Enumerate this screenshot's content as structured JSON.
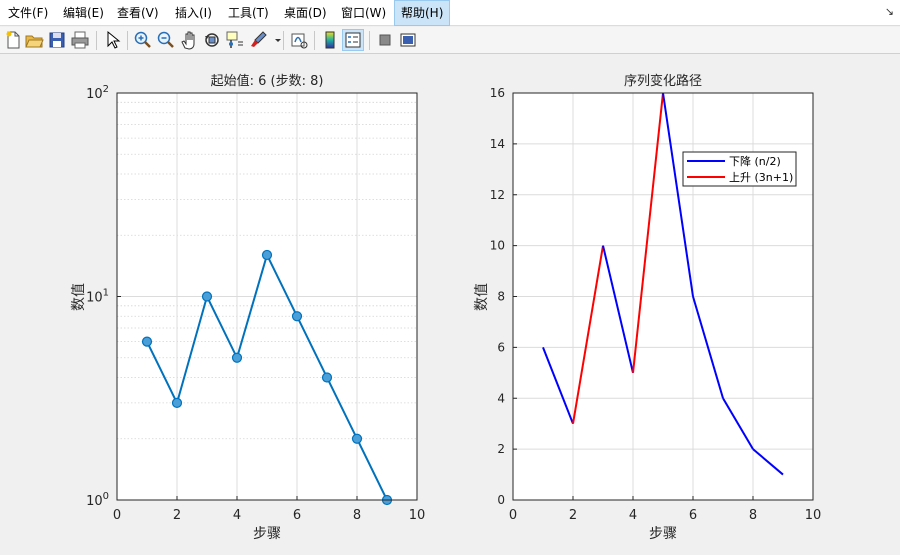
{
  "menu": {
    "items": [
      "文件(F)",
      "编辑(E)",
      "查看(V)",
      "插入(I)",
      "工具(T)",
      "桌面(D)",
      "窗口(W)",
      "帮助(H)"
    ],
    "active_index": 7,
    "dock_glyph": "↘"
  },
  "toolbar": {
    "icons": [
      "new-figure-icon",
      "open-file-icon",
      "save-icon",
      "print-icon",
      "select-pointer-icon",
      "zoom-in-icon",
      "zoom-out-icon",
      "pan-hand-icon",
      "rotate-3d-icon",
      "data-cursor-icon",
      "brush-icon",
      "link-plot-icon",
      "insert-colorbar-icon",
      "insert-legend-icon",
      "hide-plot-tools-icon",
      "show-plot-tools-icon"
    ]
  },
  "chart_data": [
    {
      "type": "line",
      "title": "起始值: 6 (步数: 8)",
      "xlabel": "步骤",
      "ylabel": "数值",
      "yscale": "log",
      "xlim": [
        0,
        10
      ],
      "ylim": [
        1,
        100
      ],
      "xticks": [
        0,
        2,
        4,
        6,
        8,
        10
      ],
      "yticks": [
        {
          "base": "10",
          "exp": "0"
        },
        {
          "base": "10",
          "exp": "1"
        },
        {
          "base": "10",
          "exp": "2"
        }
      ],
      "grid": true,
      "markers": "circle",
      "color": "#0072bd",
      "marker_fill": "#4a9fd8",
      "x": [
        1,
        2,
        3,
        4,
        5,
        6,
        7,
        8,
        9
      ],
      "y": [
        6,
        3,
        10,
        5,
        16,
        8,
        4,
        2,
        1
      ]
    },
    {
      "type": "line",
      "title": "序列变化路径",
      "xlabel": "步骤",
      "ylabel": "数值",
      "xlim": [
        0,
        10
      ],
      "ylim": [
        0,
        16
      ],
      "xticks": [
        0,
        2,
        4,
        6,
        8,
        10
      ],
      "yticks": [
        0,
        2,
        4,
        6,
        8,
        10,
        12,
        14,
        16
      ],
      "grid": true,
      "x": [
        1,
        2,
        3,
        4,
        5,
        6,
        7,
        8,
        9
      ],
      "y": [
        6,
        3,
        10,
        5,
        16,
        8,
        4,
        2,
        1
      ],
      "segment_colors": [
        "#0000ff",
        "#ff0000",
        "#0000ff",
        "#ff0000",
        "#0000ff",
        "#0000ff",
        "#0000ff",
        "#0000ff"
      ],
      "legend_position": "top-right",
      "legend": [
        {
          "label": "下降 (n/2)",
          "color": "#0000ff"
        },
        {
          "label": "上升 (3n+1)",
          "color": "#ff0000"
        }
      ]
    }
  ]
}
